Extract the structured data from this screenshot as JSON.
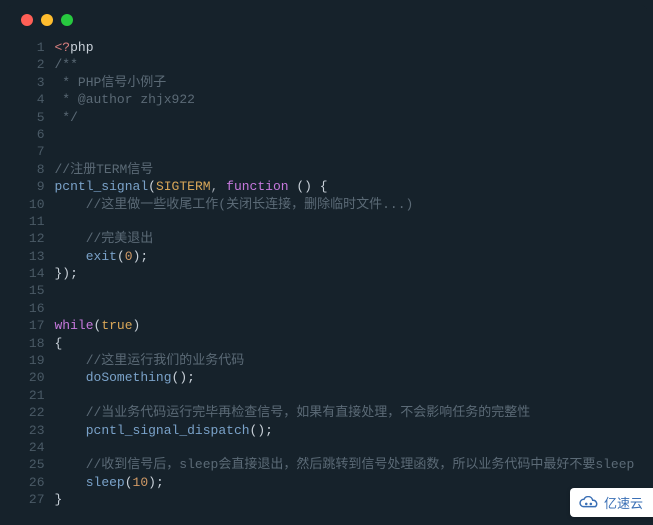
{
  "window": {
    "traffic_lights": [
      "close",
      "minimize",
      "zoom"
    ]
  },
  "code": {
    "line_count": 27,
    "l1_open": "<?",
    "l1_php": "php",
    "l2": "/**",
    "l3": " * PHP信号小例子",
    "l4": " * @author zhjx922",
    "l5": " */",
    "l6": "",
    "l7": "",
    "l8": "//注册TERM信号",
    "l9_fn": "pcntl_signal",
    "l9_p1": "(",
    "l9_const": "SIGTERM",
    "l9_comma": ", ",
    "l9_kw": "function",
    "l9_rest": " () {",
    "l10": "    //这里做一些收尾工作(关闭长连接，删除临时文件...)",
    "l11": "",
    "l12": "    //完美退出",
    "l13_pad": "    ",
    "l13_fn": "exit",
    "l13_p1": "(",
    "l13_num": "0",
    "l13_p2": ");",
    "l14": "});",
    "l15": "",
    "l16": "",
    "l17_kw": "while",
    "l17_p1": "(",
    "l17_true": "true",
    "l17_p2": ")",
    "l18": "{",
    "l19": "    //这里运行我们的业务代码",
    "l20_pad": "    ",
    "l20_fn": "doSomething",
    "l20_rest": "();",
    "l21": "",
    "l22": "    //当业务代码运行完毕再检查信号，如果有直接处理，不会影响任务的完整性",
    "l23_pad": "    ",
    "l23_fn": "pcntl_signal_dispatch",
    "l23_rest": "();",
    "l24": "",
    "l25": "    //收到信号后，sleep会直接退出，然后跳转到信号处理函数，所以业务代码中最好不要sleep",
    "l26_pad": "    ",
    "l26_fn": "sleep",
    "l26_p1": "(",
    "l26_num": "10",
    "l26_p2": ");",
    "l27": "}"
  },
  "badge": {
    "text": "亿速云"
  }
}
